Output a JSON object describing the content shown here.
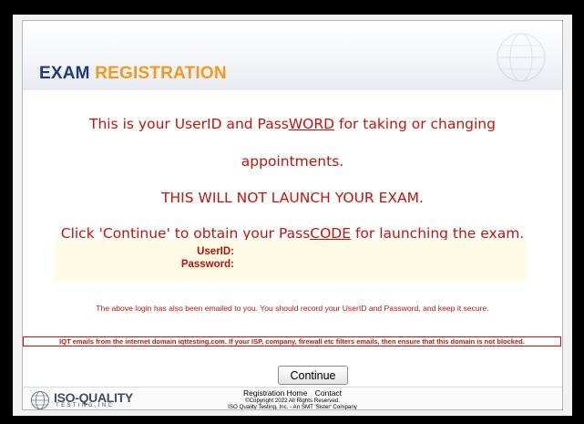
{
  "header": {
    "title_word1": "EXAM",
    "title_word2": "REGISTRATION",
    "title_color1": "#1f3b7a",
    "title_color2": "#f39a1e"
  },
  "messages": {
    "line1_prefix": "This is your UserID and Pass",
    "line1_underlined": "WORD",
    "line1_suffix": " for taking or changing",
    "line2": "appointments.",
    "line3": "THIS WILL NOT LAUNCH YOUR EXAM.",
    "line4_prefix": "Click 'Continue' to obtain your Pass",
    "line4_underlined": "CODE",
    "line4_suffix": " for launching the exam.",
    "color": "#c0140c"
  },
  "credentials": {
    "userid_label": "UserID:",
    "password_label": "Password:",
    "userid_value": "",
    "password_value": ""
  },
  "notice": "The above login has also been emailed to you. You should record your UserID and Password, and keep it secure.",
  "warning": "IQT emails from the internet domain iqttesting.com. If your ISP, company, firewall etc filters emails, then ensure that this domain is not blocked.",
  "continue_label": "Continue",
  "footer": {
    "logo_name": "ISO-QUALITY",
    "logo_sub": "TESTING,INC",
    "link_home": "Registration Home",
    "link_contact": "Contact",
    "copyright": "©Copyright 2022 All Rights Reserved.",
    "company": "ISO Quality Testing, Inc. - An SMT 'Sister' Company",
    "logo_icon": "globe-icon"
  }
}
